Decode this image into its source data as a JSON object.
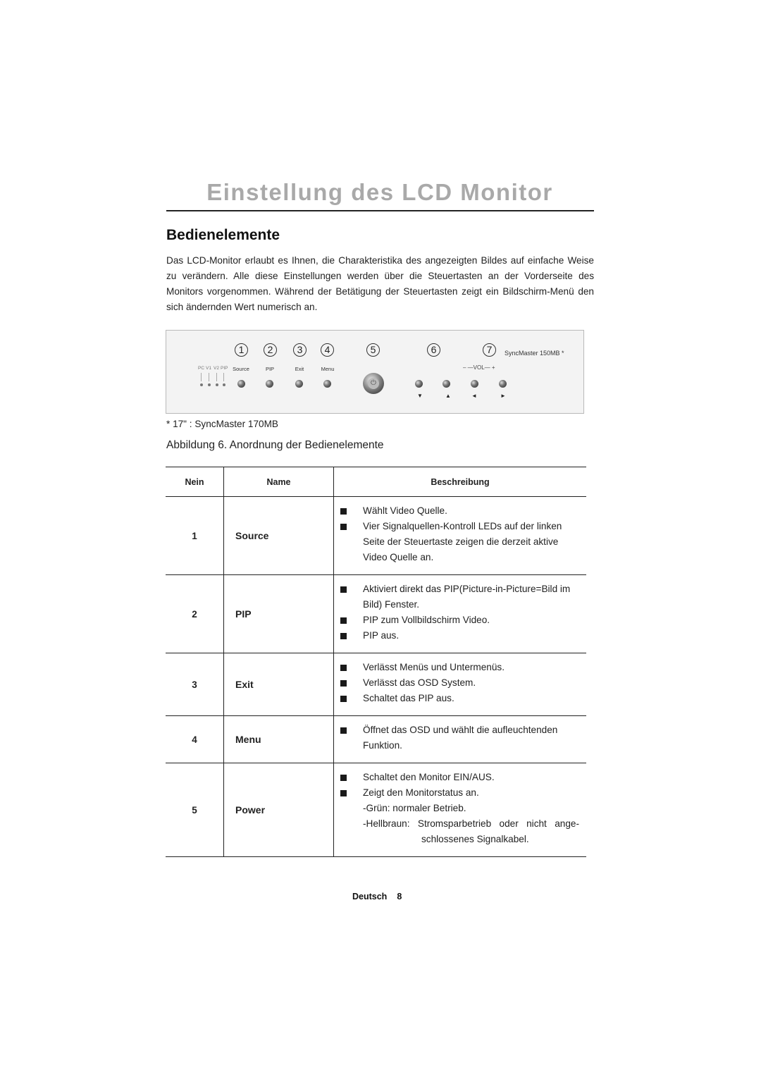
{
  "page": {
    "title": "Einstellung des LCD Monitor",
    "section_heading": "Bedienelemente",
    "intro": "Das LCD-Monitor erlaubt es Ihnen, die Charakteristika des angezeigten Bildes auf einfache Weise zu verändern. Alle diese Einstellungen werden über die Steuertasten an der Vorderseite des Monitors vorgenommen. Während der Betätigung der Steuertasten zeigt ein Bildschirm-Menü den sich ändernden Wert numerisch an."
  },
  "figure": {
    "numbers": [
      "1",
      "2",
      "3",
      "4",
      "5",
      "6",
      "7"
    ],
    "led_labels": [
      "PC",
      "V1",
      "V2",
      "PIP"
    ],
    "button_labels": [
      "Source",
      "PIP",
      "Exit",
      "Menu"
    ],
    "volume_label": "– —VOL— +",
    "model_label": "SyncMaster 150MB *",
    "power_icon": "power-icon",
    "arrow_icons": [
      "down-arrow",
      "up-arrow",
      "left-arrow",
      "right-arrow"
    ],
    "footnote": "*  17\" : SyncMaster 170MB",
    "caption": "Abbildung 6.  Anordnung der Bedienelemente"
  },
  "table": {
    "headers": {
      "no": "Nein",
      "name": "Name",
      "description": "Beschreibung"
    },
    "rows": [
      {
        "no": "1",
        "name": "Source",
        "bullets": [
          "Wählt Video Quelle.",
          "Vier Signalquellen-Kontroll LEDs auf der linken Seite der Steuertaste zeigen die derzeit aktive Video Quelle an."
        ]
      },
      {
        "no": "2",
        "name": "PIP",
        "bullets": [
          "Aktiviert direkt das PIP(Picture-in-Picture=Bild im Bild) Fenster.",
          "PIP zum Vollbildschirm Video.",
          "PIP aus."
        ]
      },
      {
        "no": "3",
        "name": "Exit",
        "bullets": [
          "Verlässt Menüs und Untermenüs.",
          "Verlässt das OSD System.",
          "Schaltet das PIP aus."
        ]
      },
      {
        "no": "4",
        "name": "Menu",
        "bullets": [
          "Öffnet das OSD und wählt die aufleuchtenden Funktion."
        ]
      },
      {
        "no": "5",
        "name": "Power",
        "bullets": [
          "Schaltet den Monitor EIN/AUS.",
          "Zeigt den Monitorstatus an."
        ],
        "notes": [
          "-Grün: normaler Betrieb.",
          "-Hellbraun: Stromsparbetrieb oder nicht ange-"
        ],
        "note_continuation": "schlossenes Signalkabel."
      }
    ]
  },
  "footer": {
    "language": "Deutsch",
    "page_number": "8"
  }
}
